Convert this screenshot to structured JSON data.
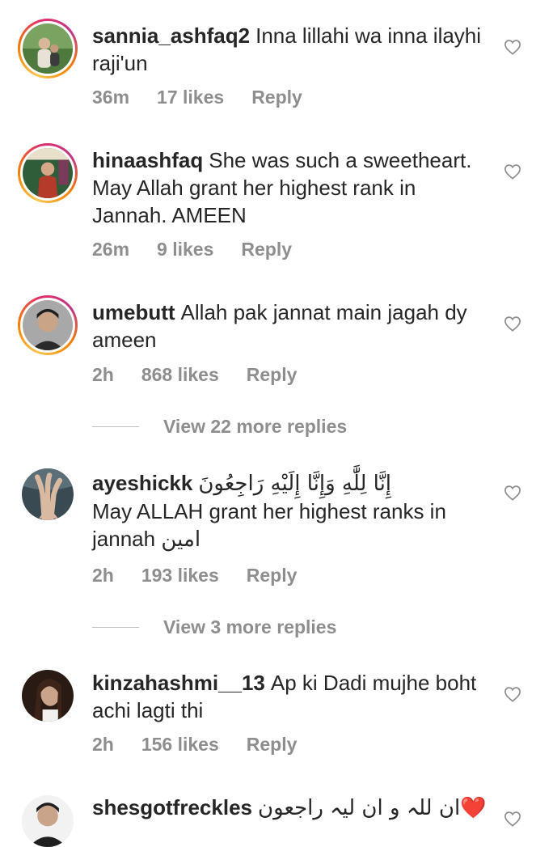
{
  "comments": [
    {
      "username": "sannia_ashfaq2",
      "text": "Inna lillahi wa inna ilayhi raji'un",
      "time": "36m",
      "likes": "17 likes",
      "reply": "Reply",
      "avatar_colors": [
        "#5a8a4a",
        "#c8b89a"
      ]
    },
    {
      "username": "hinaashfaq",
      "text": "She was such a sweetheart. May Allah grant her highest rank in Jannah. AMEEN",
      "time": "26m",
      "likes": "9 likes",
      "reply": "Reply",
      "avatar_colors": [
        "#2f5d3a",
        "#b43a2a"
      ]
    },
    {
      "username": "umebutt",
      "text": "Allah pak jannat main jagah dy ameen",
      "time": "2h",
      "likes": "868 likes",
      "reply": "Reply",
      "avatar_colors": [
        "#9a9a9a",
        "#2a2a2a"
      ]
    },
    {
      "username": "ayeshickk",
      "text_arabic": "إِنَّا لِلَّٰهِ وَإِنَّا إِلَيْهِ رَاجِعُونَ",
      "text": "May ALLAH grant her highest ranks in jannah",
      "text_tail": "امين",
      "time": "2h",
      "likes": "193 likes",
      "reply": "Reply",
      "avatar_colors": [
        "#3a4a52",
        "#d9b9a0"
      ]
    },
    {
      "username": "kinzahashmi__13",
      "text": "Ap ki Dadi mujhe boht achi lagti thi",
      "time": "2h",
      "likes": "156 likes",
      "reply": "Reply",
      "avatar_colors": [
        "#2a1a14",
        "#c9a38a"
      ]
    },
    {
      "username": "shesgotfreckles",
      "text_arabic": "ان للہ و ان لیہ راجعون",
      "text_emoji": "❤️",
      "avatar_colors": [
        "#f2f2f2",
        "#1f1f1f"
      ]
    }
  ],
  "view_more": [
    {
      "label": "View 22 more replies"
    },
    {
      "label": "View 3 more replies"
    }
  ],
  "icons": {
    "like": "heart-outline-icon"
  },
  "colors": {
    "text": "#262626",
    "meta": "#8e8e8e",
    "heart": "#8e8e8e",
    "divider": "#bdbdbd"
  }
}
